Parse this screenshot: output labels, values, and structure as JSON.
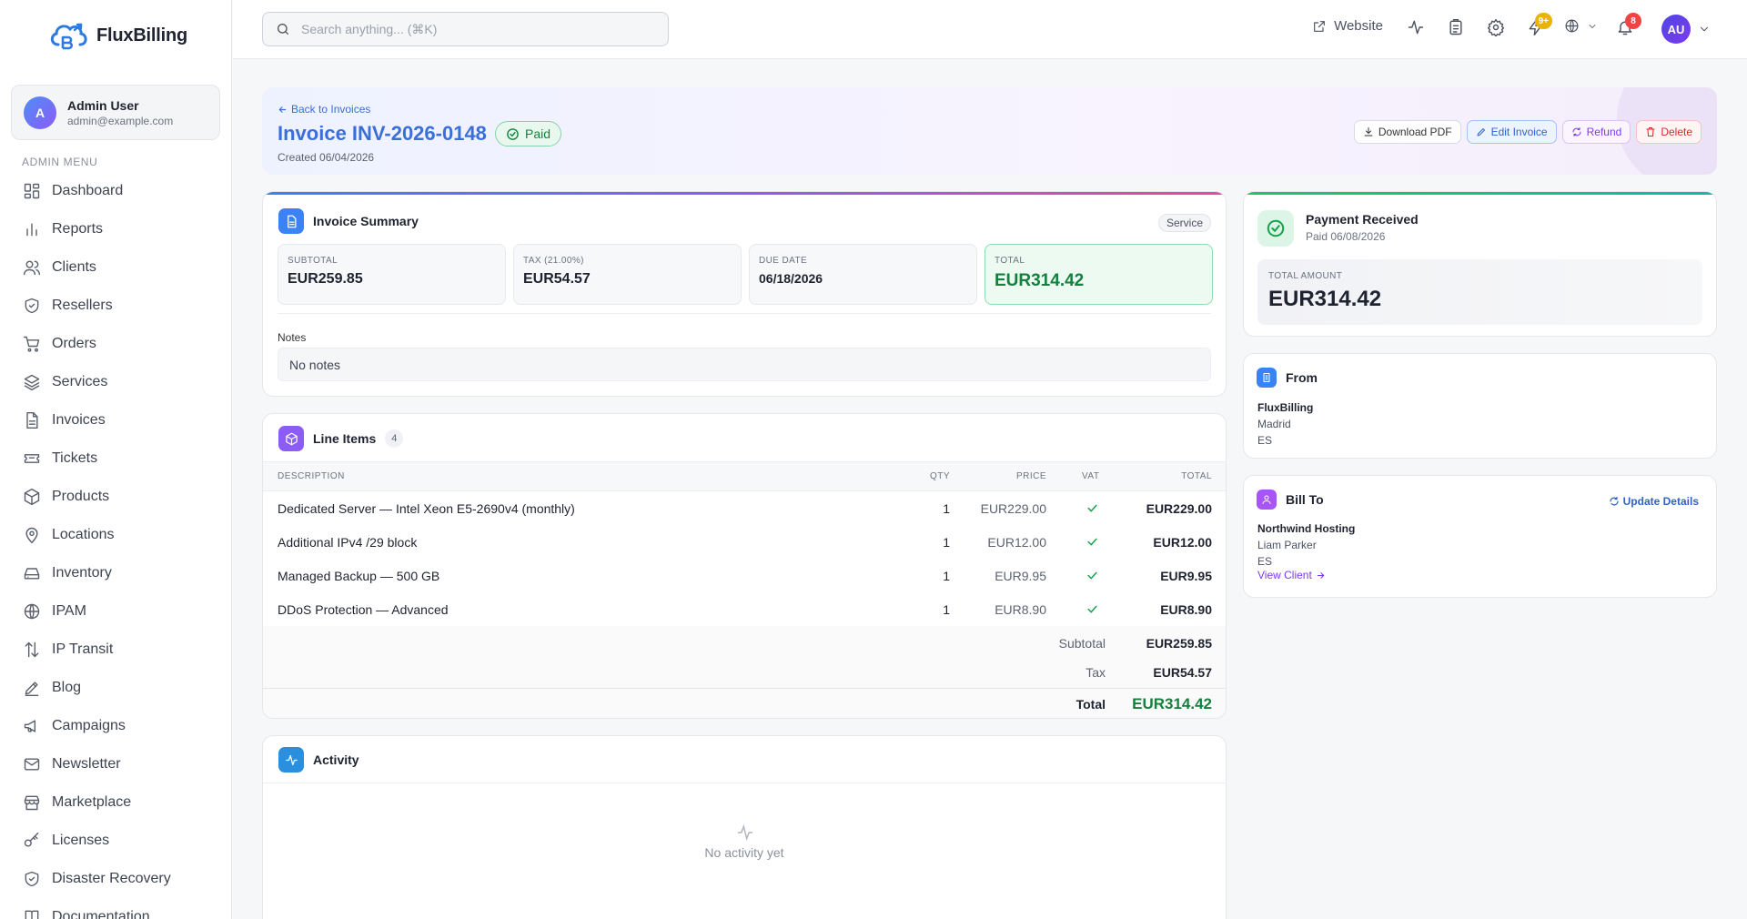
{
  "app": {
    "name": "FluxBilling"
  },
  "user": {
    "initial": "A",
    "name": "Admin User",
    "email": "admin@example.com"
  },
  "sidebar": {
    "heading": "ADMIN MENU",
    "items": [
      {
        "label": "Dashboard",
        "icon": "dashboard-icon"
      },
      {
        "label": "Reports",
        "icon": "bar-chart-icon"
      },
      {
        "label": "Clients",
        "icon": "users-icon"
      },
      {
        "label": "Resellers",
        "icon": "shield-icon"
      },
      {
        "label": "Orders",
        "icon": "cart-icon"
      },
      {
        "label": "Services",
        "icon": "layers-icon"
      },
      {
        "label": "Invoices",
        "icon": "file-icon"
      },
      {
        "label": "Tickets",
        "icon": "ticket-icon"
      },
      {
        "label": "Products",
        "icon": "box-icon"
      },
      {
        "label": "Locations",
        "icon": "map-pin-icon"
      },
      {
        "label": "Inventory",
        "icon": "hard-drive-icon"
      },
      {
        "label": "IPAM",
        "icon": "globe-icon"
      },
      {
        "label": "IP Transit",
        "icon": "arrows-icon"
      },
      {
        "label": "Blog",
        "icon": "pen-icon"
      },
      {
        "label": "Campaigns",
        "icon": "megaphone-icon"
      },
      {
        "label": "Newsletter",
        "icon": "mail-icon"
      },
      {
        "label": "Marketplace",
        "icon": "store-icon"
      },
      {
        "label": "Licenses",
        "icon": "key-icon"
      },
      {
        "label": "Disaster Recovery",
        "icon": "shield-check-icon"
      },
      {
        "label": "Documentation",
        "icon": "book-icon"
      }
    ]
  },
  "topbar": {
    "search_placeholder": "Search anything... (⌘K)",
    "website_label": "Website",
    "lightning_badge": "9+",
    "notification_badge": "8",
    "avatar_initials": "AU"
  },
  "invoice": {
    "back_label": "Back to Invoices",
    "title": "Invoice INV-2026-0148",
    "status": "Paid",
    "created": "Created 06/04/2026",
    "actions": {
      "download": "Download PDF",
      "edit": "Edit Invoice",
      "refund": "Refund",
      "delete": "Delete"
    }
  },
  "summary": {
    "title": "Invoice Summary",
    "type_badge": "Service",
    "subtotal_label": "SUBTOTAL",
    "subtotal": "EUR259.85",
    "tax_label": "TAX (21.00%)",
    "tax": "EUR54.57",
    "due_label": "DUE DATE",
    "due": "06/18/2026",
    "total_label": "TOTAL",
    "total": "EUR314.42",
    "notes_label": "Notes",
    "notes": "No notes"
  },
  "line_items": {
    "title": "Line Items",
    "count": "4",
    "headers": {
      "description": "DESCRIPTION",
      "qty": "QTY",
      "price": "PRICE",
      "vat": "VAT",
      "total": "TOTAL"
    },
    "rows": [
      {
        "description": "Dedicated Server — Intel Xeon E5-2690v4 (monthly)",
        "qty": "1",
        "price": "EUR229.00",
        "total": "EUR229.00"
      },
      {
        "description": "Additional IPv4 /29 block",
        "qty": "1",
        "price": "EUR12.00",
        "total": "EUR12.00"
      },
      {
        "description": "Managed Backup — 500 GB",
        "qty": "1",
        "price": "EUR9.95",
        "total": "EUR9.95"
      },
      {
        "description": "DDoS Protection — Advanced",
        "qty": "1",
        "price": "EUR8.90",
        "total": "EUR8.90"
      }
    ],
    "subtotal_label": "Subtotal",
    "subtotal": "EUR259.85",
    "tax_label": "Tax",
    "tax": "EUR54.57",
    "total_label": "Total",
    "total": "EUR314.42"
  },
  "activity": {
    "title": "Activity",
    "empty": "No activity yet"
  },
  "payment": {
    "title": "Payment Received",
    "paid_date": "Paid 06/08/2026",
    "amount_label": "TOTAL AMOUNT",
    "amount": "EUR314.42"
  },
  "from": {
    "title": "From",
    "company": "FluxBilling",
    "city": "Madrid",
    "country": "ES"
  },
  "bill_to": {
    "title": "Bill To",
    "update_label": "Update Details",
    "company": "Northwind Hosting",
    "contact": "Liam Parker",
    "country": "ES",
    "view_client": "View Client"
  },
  "colors": {
    "accent": "#3b6fd8",
    "success": "#15803d",
    "danger": "#dc2626",
    "purple": "#7c3aed"
  }
}
